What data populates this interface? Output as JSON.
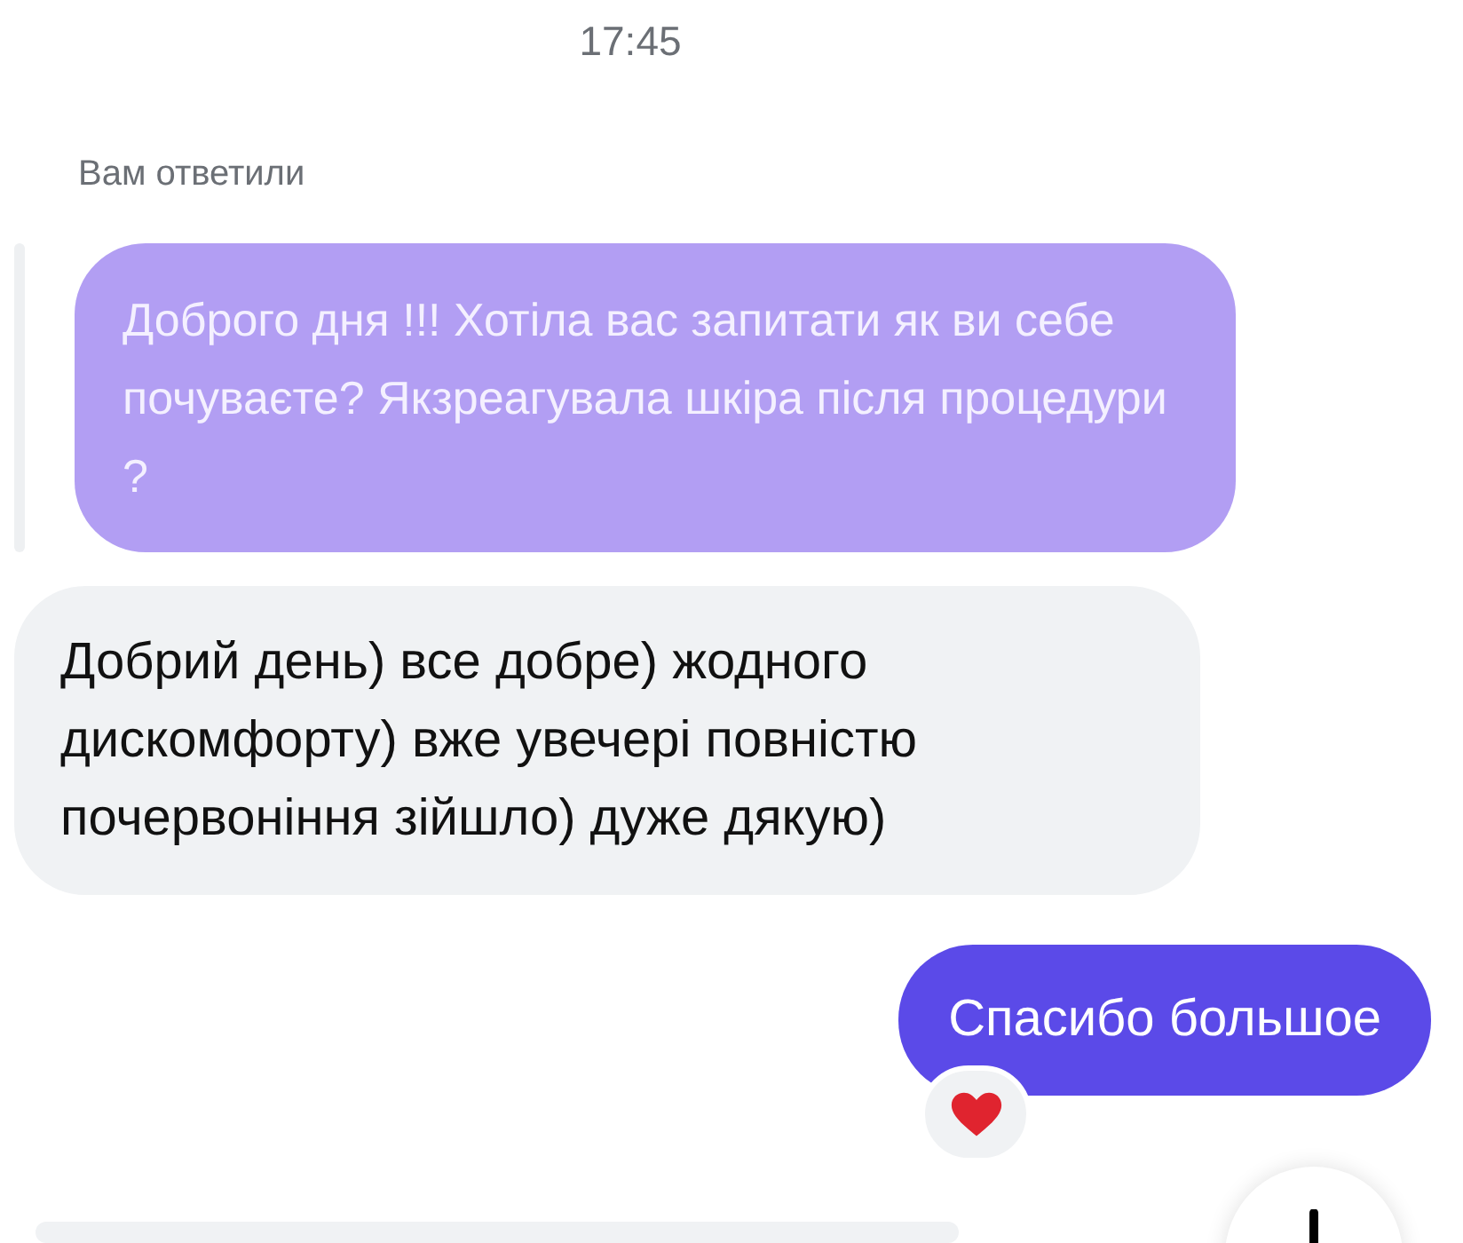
{
  "time": "17:45",
  "reply_label": "Вам ответили",
  "quoted_message": {
    "text": "Доброго дня !!! Хотіла вас запитати як ви себе почуваєте? Якзреагувала шкіра після процедури ?"
  },
  "messages": [
    {
      "kind": "incoming",
      "text": "Добрий день) все добре) жодного дискомфорту) вже увечері повністю почервоніння зійшло) дуже дякую)"
    },
    {
      "kind": "outgoing",
      "text": "Спасибо большое",
      "reaction": {
        "kind": "heart"
      }
    },
    {
      "kind": "incoming"
    }
  ]
}
